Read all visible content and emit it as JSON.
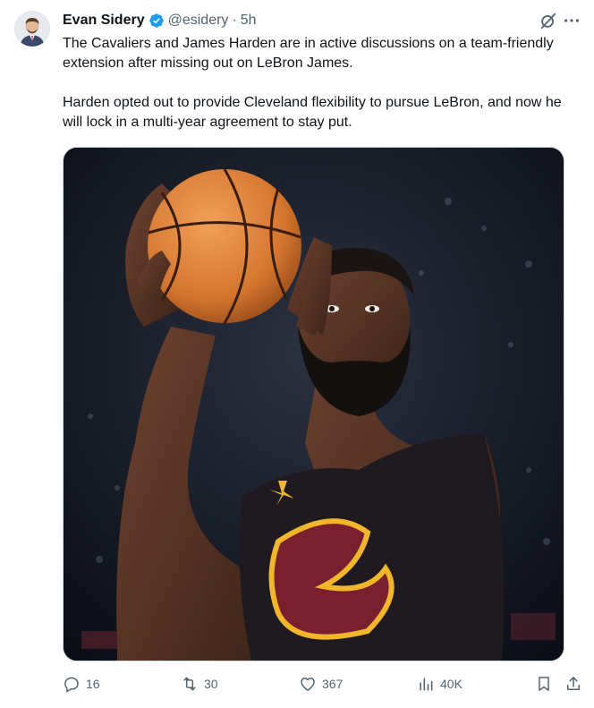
{
  "author": {
    "name": "Evan Sidery",
    "handle": "@esidery",
    "separator": "·",
    "time": "5h",
    "verified": true
  },
  "tweet": {
    "paragraph_1": "The Cavaliers and James Harden are in active discussions on a team-friendly extension after missing out on LeBron James.",
    "paragraph_2": "Harden opted out to provide Cleveland flexibility to pursue LeBron, and now he will lock in a multi-year agreement to stay put."
  },
  "media": {
    "jersey_color": "#1f1a20",
    "accent_wine": "#7a1f2e",
    "accent_gold": "#f1b62a"
  },
  "actions": {
    "reply_count": "16",
    "retweet_count": "30",
    "like_count": "367",
    "view_count": "40K"
  },
  "colors": {
    "text_primary": "#0f1419",
    "text_secondary": "#536471",
    "verified_blue": "#1d9bf0",
    "border": "#cfd9de"
  },
  "icons": [
    "grok-icon",
    "more-icon",
    "reply-icon",
    "retweet-icon",
    "like-icon",
    "views-icon",
    "bookmark-icon",
    "share-icon",
    "verified-badge-icon"
  ]
}
